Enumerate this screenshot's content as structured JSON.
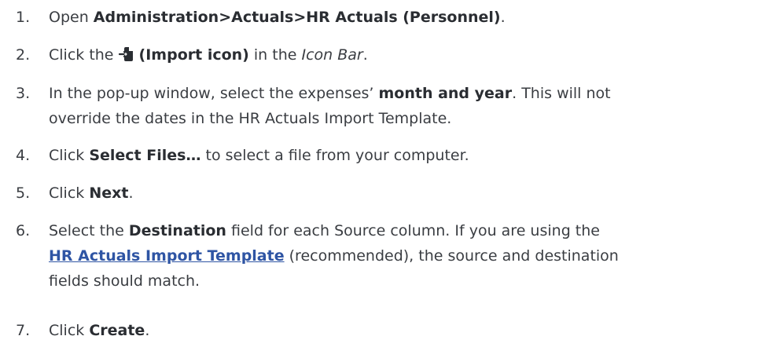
{
  "steps": [
    {
      "num": "1.",
      "t1": "Open ",
      "b1": "Administration>Actuals>HR Actuals (Personnel)",
      "t2": "."
    },
    {
      "num": "2.",
      "t1": "Click the ",
      "icon": "import-icon",
      "b1": "(Import icon)",
      "t2": " in the ",
      "i1": "Icon Bar",
      "t3": "."
    },
    {
      "num": "3.",
      "t1": "In the pop-up window, select the expenses’ ",
      "b1": "month and year",
      "t2": ". This will not",
      "line2": "override the dates in the HR Actuals Import Template."
    },
    {
      "num": "4.",
      "t1": "Click ",
      "b1": "Select Files…",
      "t2": " to select a file from your computer."
    },
    {
      "num": "5.",
      "t1": "Click ",
      "b1": "Next",
      "t2": "."
    },
    {
      "num": "6.",
      "t1": "Select the ",
      "b1": "Destination",
      "t2": " field for each Source column. If you are using the",
      "link": "HR Actuals Import Template",
      "t3": " (recommended), the source and destination",
      "line3": "fields should match."
    },
    {
      "num": "7.",
      "t1": "Click ",
      "b1": "Create",
      "t2": "."
    }
  ],
  "colors": {
    "text": "#3a3d42",
    "link": "#2f55a4"
  }
}
